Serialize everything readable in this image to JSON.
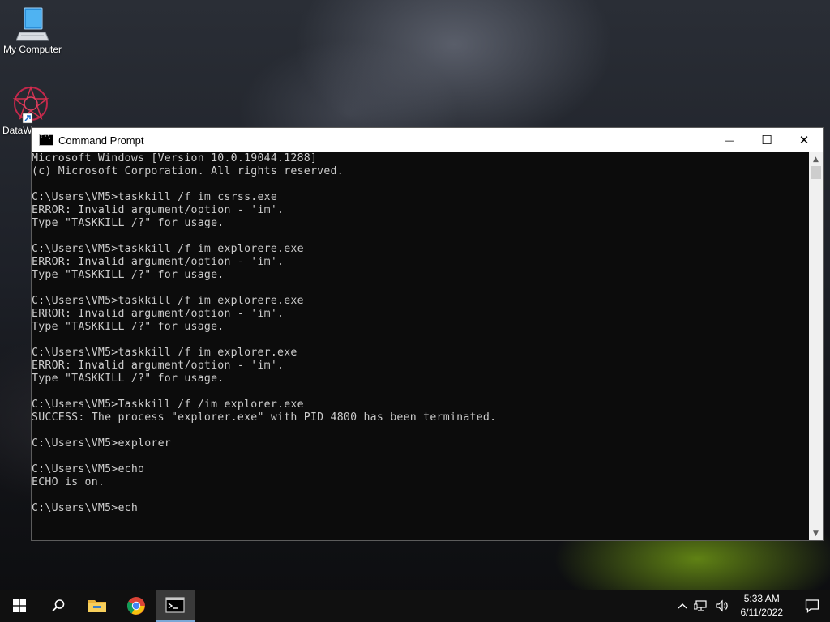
{
  "desktop": {
    "icons": [
      {
        "label": "My Computer",
        "icon": "computer-icon"
      },
      {
        "label": "DataW",
        "icon": "dataw-app-icon"
      }
    ]
  },
  "window": {
    "title": "Command Prompt",
    "controls": {
      "minimize": "—",
      "maximize": "☐",
      "close": "✕"
    },
    "lines": [
      "Microsoft Windows [Version 10.0.19044.1288]",
      "(c) Microsoft Corporation. All rights reserved.",
      "",
      "C:\\Users\\VM5>taskkill /f im csrss.exe",
      "ERROR: Invalid argument/option - 'im'.",
      "Type \"TASKKILL /?\" for usage.",
      "",
      "C:\\Users\\VM5>taskkill /f im explorere.exe",
      "ERROR: Invalid argument/option - 'im'.",
      "Type \"TASKKILL /?\" for usage.",
      "",
      "C:\\Users\\VM5>taskkill /f im explorere.exe",
      "ERROR: Invalid argument/option - 'im'.",
      "Type \"TASKKILL /?\" for usage.",
      "",
      "C:\\Users\\VM5>taskkill /f im explorer.exe",
      "ERROR: Invalid argument/option - 'im'.",
      "Type \"TASKKILL /?\" for usage.",
      "",
      "C:\\Users\\VM5>Taskkill /f /im explorer.exe",
      "SUCCESS: The process \"explorer.exe\" with PID 4800 has been terminated.",
      "",
      "C:\\Users\\VM5>explorer",
      "",
      "C:\\Users\\VM5>echo",
      "ECHO is on.",
      "",
      "C:\\Users\\VM5>ech"
    ]
  },
  "taskbar": {
    "buttons": [
      {
        "name": "start-button",
        "icon": "windows-logo-icon"
      },
      {
        "name": "search-button",
        "icon": "search-icon"
      },
      {
        "name": "file-explorer-button",
        "icon": "folder-icon"
      },
      {
        "name": "chrome-button",
        "icon": "chrome-icon"
      },
      {
        "name": "cmd-button",
        "icon": "cmd-icon",
        "active": true
      }
    ],
    "clock": {
      "time": "5:33 AM",
      "date": "6/11/2022"
    }
  }
}
